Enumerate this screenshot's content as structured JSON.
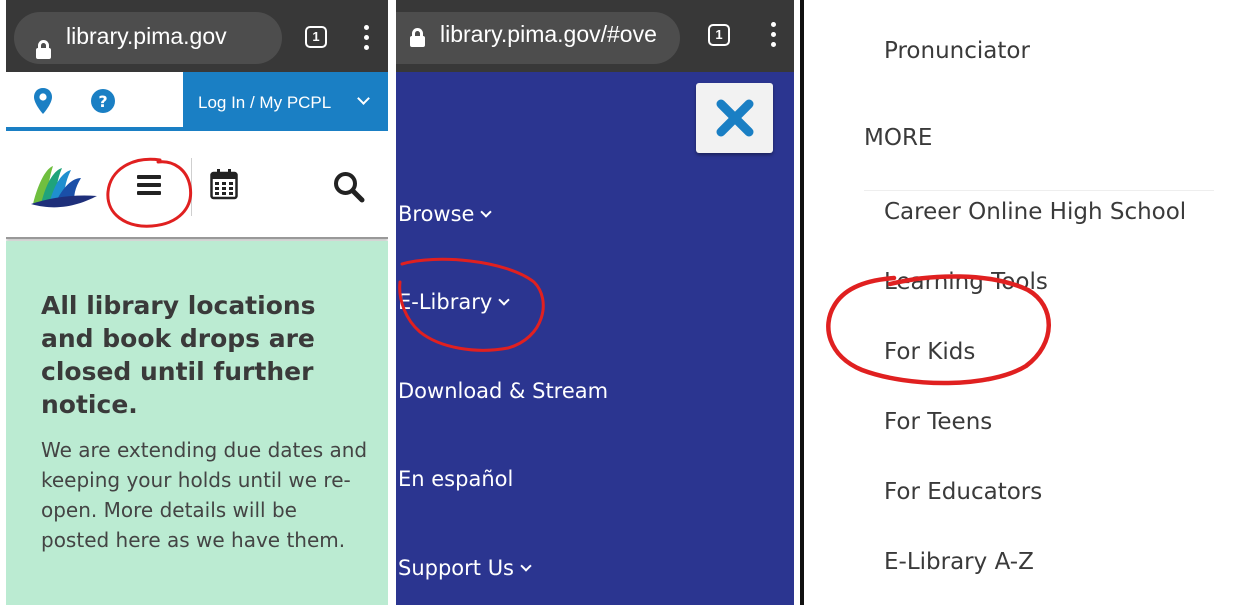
{
  "colors": {
    "browser_bar": "#383838",
    "pcpl_blue": "#1a7fc4",
    "notice_green": "#bbebd2",
    "menu_navy": "#2b3590",
    "annotation_red": "#e02020"
  },
  "panel1": {
    "browser": {
      "url": "library.pima.gov",
      "tab_count": "1",
      "icons": [
        "lock-icon",
        "tab-switcher-icon",
        "more-options-icon"
      ]
    },
    "util_bar": {
      "login_label": "Log In / My PCPL",
      "icons": [
        "location-pin-icon",
        "help-icon",
        "chevron-down-icon"
      ]
    },
    "nav_icons": [
      "library-logo",
      "hamburger-menu-icon",
      "calendar-icon",
      "search-icon"
    ],
    "notice": {
      "heading": "All library locations and book drops are closed until further notice.",
      "body": "We are extending due dates and keeping your holds until we re-open. More details will be posted here as we have them."
    }
  },
  "panel2": {
    "browser": {
      "url": "library.pima.gov/#ove",
      "tab_count": "1"
    },
    "menu_items": [
      {
        "label": "Browse",
        "has_chevron": true
      },
      {
        "label": "E-Library",
        "has_chevron": true
      },
      {
        "label": "Download & Stream",
        "has_chevron": false
      },
      {
        "label": "En español",
        "has_chevron": false
      },
      {
        "label": "Support Us",
        "has_chevron": true
      }
    ]
  },
  "panel3": {
    "top_item": "Pronunciator",
    "section_title": "MORE",
    "items": [
      "Career Online High School",
      "Learning Tools",
      "For Kids",
      "For Teens",
      "For Educators",
      "E-Library A-Z"
    ]
  }
}
